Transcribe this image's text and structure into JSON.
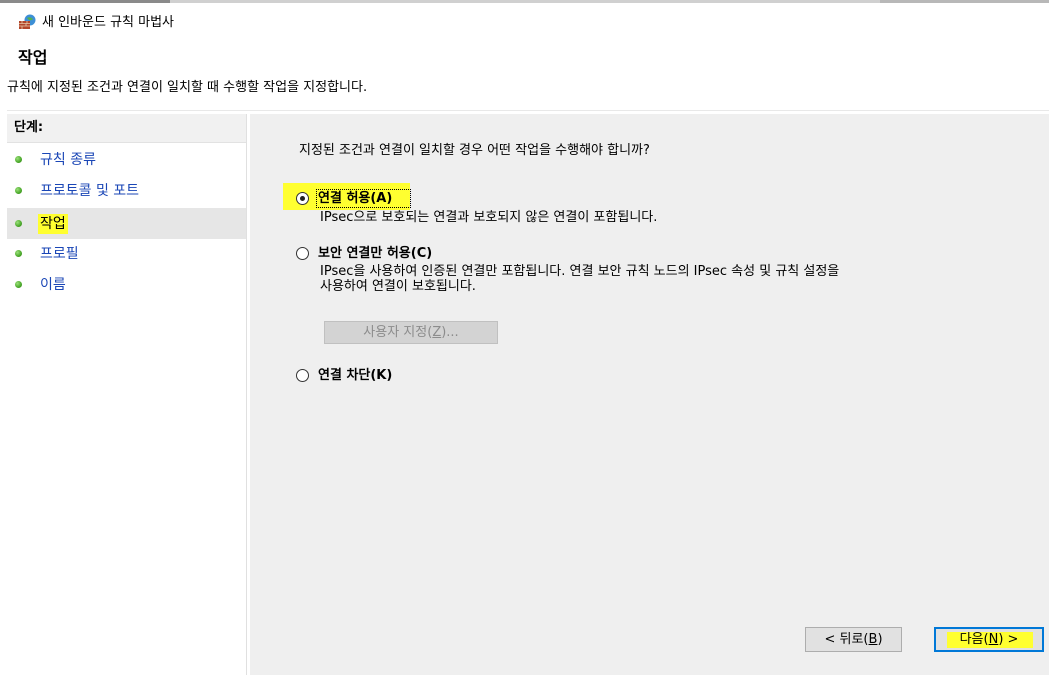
{
  "window": {
    "title": "새 인바운드 규칙 마법사",
    "icon": "firewall-icon"
  },
  "header": {
    "title": "작업",
    "description": "규칙에 지정된 조건과 연결이 일치할 때 수행할 작업을 지정합니다."
  },
  "steps": {
    "header": "단계:",
    "items": [
      {
        "label": "규칙 종류",
        "active": false
      },
      {
        "label": "프로토콜 및 포트",
        "active": false
      },
      {
        "label": "작업",
        "active": true
      },
      {
        "label": "프로필",
        "active": false
      },
      {
        "label": "이름",
        "active": false
      }
    ]
  },
  "main": {
    "question": "지정된 조건과 연결이 일치할 경우 어떤 작업을 수행해야 합니까?",
    "options": [
      {
        "label": "연결 허용(A)",
        "checked": true,
        "description": [
          "IPsec으로 보호되는 연결과 보호되지 않은 연결이 포함됩니다."
        ]
      },
      {
        "label": "보안 연결만 허용(C)",
        "checked": false,
        "description": [
          "IPsec을 사용하여 인증된 연결만 포함됩니다. 연결 보안 규칙 노드의 IPsec 속성 및 규칙 설정을",
          "사용하여 연결이 보호됩니다."
        ]
      },
      {
        "label": "연결 차단(K)",
        "checked": false,
        "description": []
      }
    ],
    "customize_button": {
      "label_pre": "사용자 지정(",
      "label_key": "Z",
      "label_post": ")...",
      "enabled": false
    }
  },
  "footer": {
    "back_button": {
      "label_pre": "< 뒤로(",
      "label_key": "B",
      "label_post": ")"
    },
    "next_button": {
      "label_pre": "다음(",
      "label_key": "N",
      "label_post": ") >"
    }
  },
  "colors": {
    "highlight": "#ffff30",
    "link": "#1a46b6",
    "content_bg": "#efefef",
    "focus_border": "#0078d7"
  }
}
